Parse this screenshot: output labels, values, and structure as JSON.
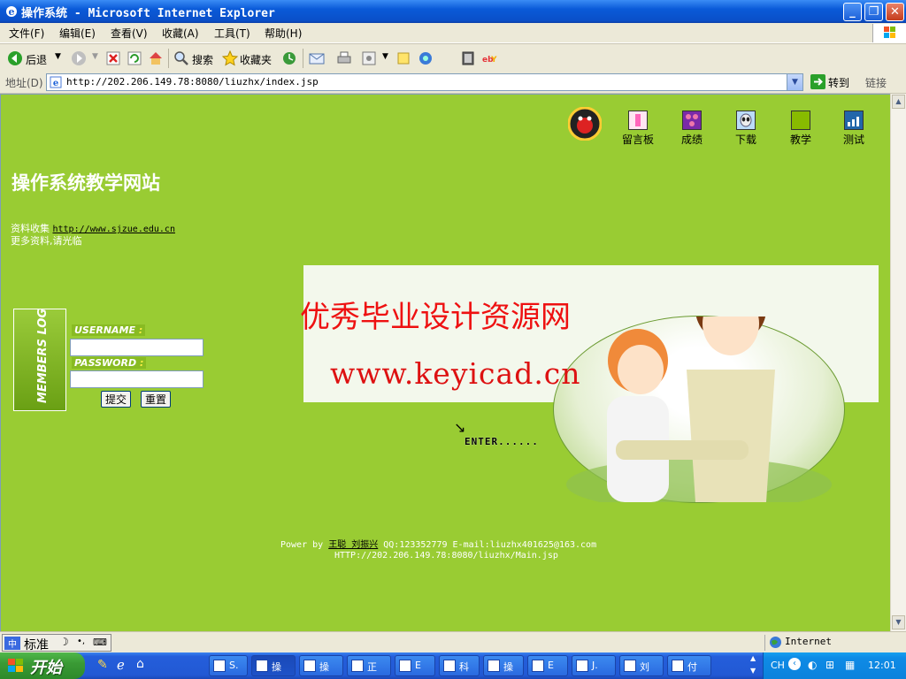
{
  "window": {
    "title": "操作系统 - Microsoft Internet Explorer"
  },
  "menu": [
    "文件(F)",
    "编辑(E)",
    "查看(V)",
    "收藏(A)",
    "工具(T)",
    "帮助(H)"
  ],
  "toolbar": {
    "back": "后退",
    "search": "搜索",
    "favorites": "收藏夹"
  },
  "address": {
    "label": "地址(D)",
    "url": "http://202.206.149.78:8080/liuzhx/index.jsp",
    "go": "转到",
    "links": "链接"
  },
  "site": {
    "title": "操作系统教学网站",
    "info_prefix": "资料收集",
    "info_link": "http://www.sjzue.edu.cn",
    "info_line2": "更多资料,请光临"
  },
  "nav": [
    {
      "label": "留言板",
      "color": "#ff88cc"
    },
    {
      "label": "成绩",
      "color": "#9933cc"
    },
    {
      "label": "下载",
      "color": "#99ccff"
    },
    {
      "label": "教学",
      "color": "#88bb00"
    },
    {
      "label": "测试",
      "color": "#2266aa"
    }
  ],
  "login": {
    "badge": "MEMBERS LOGIN",
    "username_label": "USERNAME",
    "password_label": "PASSWORD",
    "colon": ":",
    "submit": "提交",
    "reset": "重置"
  },
  "banner": {
    "watermark_cn": "优秀毕业设计资源网",
    "watermark_url": "www.keyicad.cn",
    "enter": "ENTER......"
  },
  "footer": {
    "power_prefix": "Power by",
    "authors": "王聪 刘振兴",
    "contact": "QQ:123352779 E-mail:liuzhx401625@163.com",
    "url": "HTTP://202.206.149.78:8080/liuzhx/Main.jsp"
  },
  "status": {
    "ime": "标准",
    "zone": "Internet"
  },
  "taskbar": {
    "start": "开始",
    "tasks": [
      "S.",
      "操",
      "操",
      "正",
      "E",
      "科",
      "操",
      "E",
      "J.",
      "刘",
      "付"
    ],
    "lang": "CH",
    "clock": "12:01"
  },
  "colors": {
    "page_bg": "#99cc33",
    "title_bar": "#0a5ad8",
    "watermark": "#ee1111"
  }
}
